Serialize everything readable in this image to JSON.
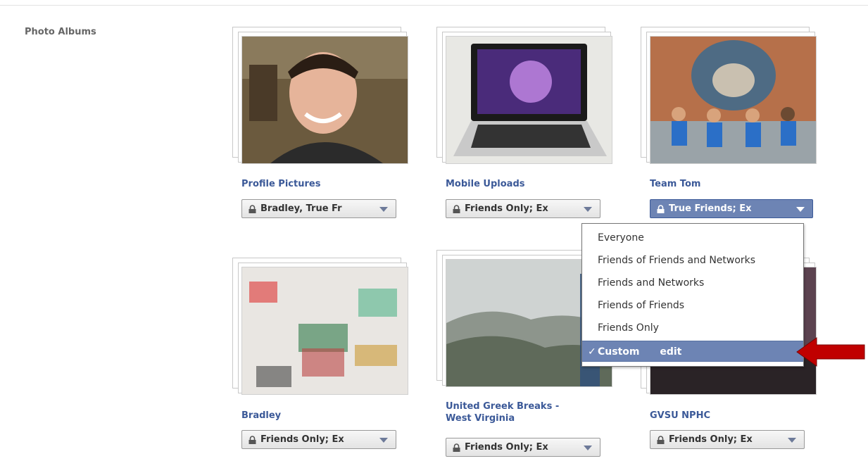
{
  "section": {
    "label": "Photo Albums"
  },
  "albums": [
    {
      "title": "Profile Pictures",
      "privacy": "Bradley, True Fr"
    },
    {
      "title": "Mobile Uploads",
      "privacy": "Friends Only; Ex"
    },
    {
      "title": "Team Tom",
      "privacy": "True Friends; Ex"
    },
    {
      "title": "Bradley",
      "privacy": "Friends Only; Ex"
    },
    {
      "title_line1": "United Greek Breaks -",
      "title_line2": "West Virginia",
      "privacy": "Friends Only; Ex"
    },
    {
      "title": "GVSU NPHC",
      "privacy": "Friends Only; Ex"
    }
  ],
  "privacy_menu": {
    "items": [
      "Everyone",
      "Friends of Friends and Networks",
      "Friends and Networks",
      "Friends of Friends",
      "Friends Only"
    ],
    "selected": {
      "check": "✓",
      "label": "Custom",
      "edit": "edit"
    }
  },
  "colors": {
    "link": "#3b5998",
    "selected_bg": "#6d84b4",
    "callout": "#c00000"
  },
  "icons": [
    "lock-icon",
    "chevron-down-icon",
    "checkmark-icon",
    "red-arrow-icon"
  ]
}
